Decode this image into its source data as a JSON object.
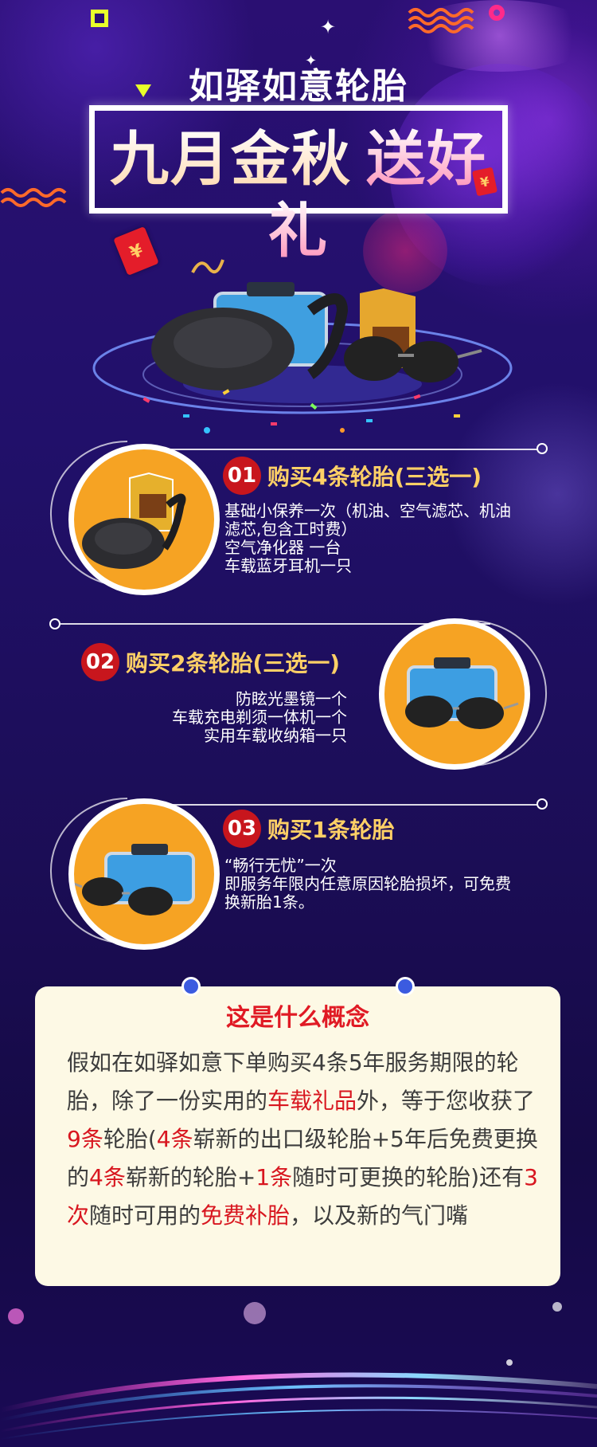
{
  "header": {
    "brand_line": "如驿如意轮胎",
    "title_part1": "九月金秋",
    "title_part2": "送好礼"
  },
  "sections": [
    {
      "number": "01",
      "title": "购买4条轮胎(三选一)",
      "lines": [
        "基础小保养一次（机油、空气滤芯、机油",
        "滤芯,包含工时费）",
        "空气净化器 一台",
        "车载蓝牙耳机一只"
      ]
    },
    {
      "number": "02",
      "title": "购买2条轮胎(三选一)",
      "lines": [
        "防眩光墨镜一个",
        "车载充电剃须一体机一个",
        "实用车载收纳箱一只"
      ]
    },
    {
      "number": "03",
      "title": "购买1条轮胎",
      "lines": [
        "“畅行无忧”一次",
        "即服务年限内任意原因轮胎损坏，可免费",
        "换新胎1条。"
      ]
    }
  ],
  "info_card": {
    "title": "这是什么概念",
    "p1": "假如在如驿如意下单购买4条5年服务期限的轮胎，除了一份实用的",
    "h1": "车载礼品",
    "p2": "外，等于您收获了",
    "h2": "9条",
    "p3": "轮胎(",
    "h3": "4条",
    "p4": "崭新的出口级轮胎+5年后免费更换的",
    "h4": "4条",
    "p5": "崭新的轮胎+",
    "h5": "1条",
    "p6": "随时可更换的轮胎)还有",
    "h6": "3次",
    "p7": "随时可用的",
    "h7": "免费补胎",
    "p8": "，以及新的气门嘴"
  },
  "decor": {
    "red_envelope_symbol": "¥",
    "icons": [
      "red-envelope-icon",
      "sparkle-icon",
      "wave-squiggle-icon",
      "triangle-icon",
      "square-icon"
    ],
    "colors": {
      "accent_red": "#c8161d",
      "title_gold": "#ffd066",
      "circle_orange": "#f6a323",
      "card_bg": "#fdf9e5",
      "highlight_red": "#d8161f"
    }
  }
}
